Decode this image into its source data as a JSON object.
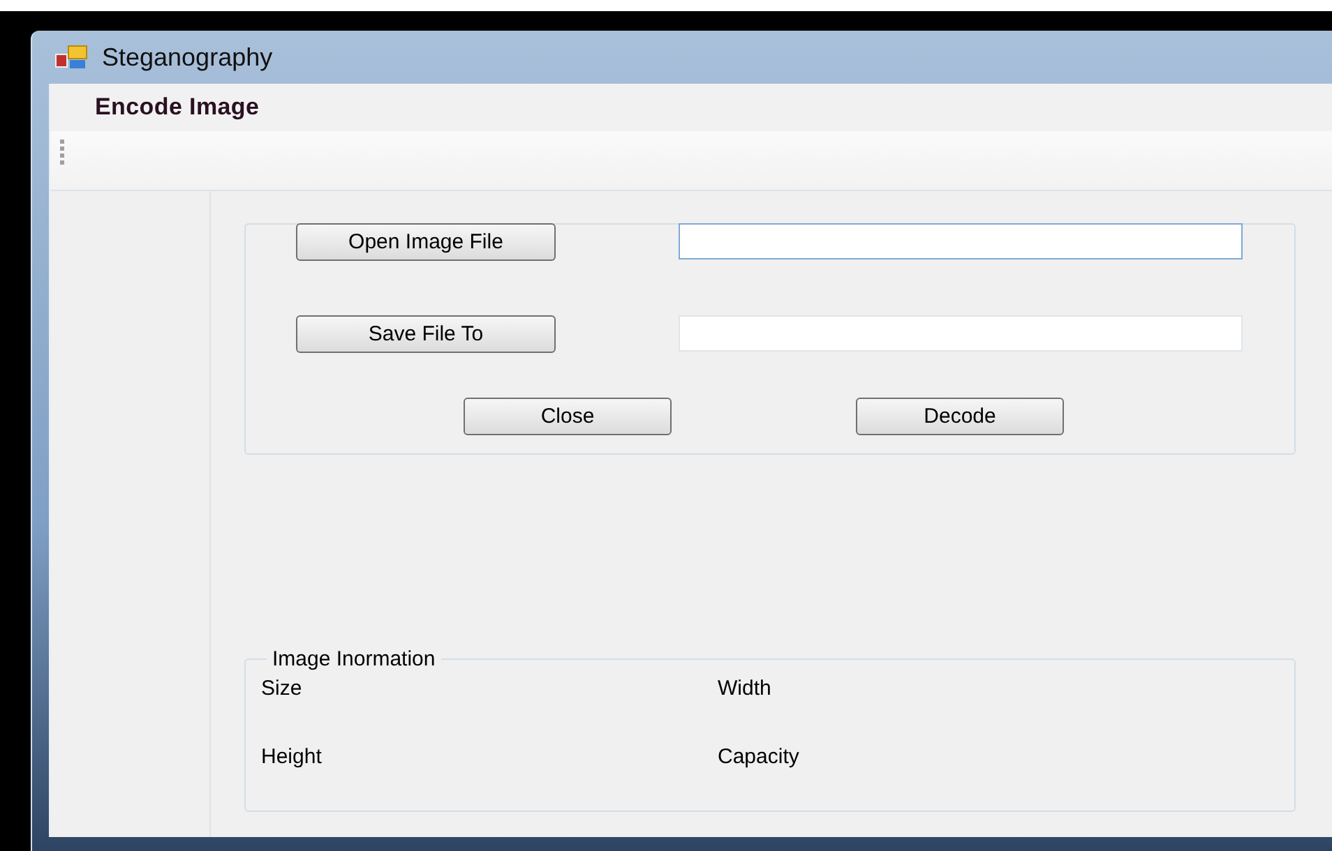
{
  "window": {
    "title": "Steganography"
  },
  "menu": [
    {
      "label": "Encode Image"
    }
  ],
  "file_rows": [
    {
      "button": "Open Image File",
      "field_focused": true
    },
    {
      "button": "Save File To",
      "field_focused": false
    }
  ],
  "actions": [
    "Close",
    "Decode"
  ],
  "image_information": {
    "title": "Image Inormation",
    "labels": [
      "Size",
      "Width",
      "Height",
      "Capacity"
    ]
  }
}
